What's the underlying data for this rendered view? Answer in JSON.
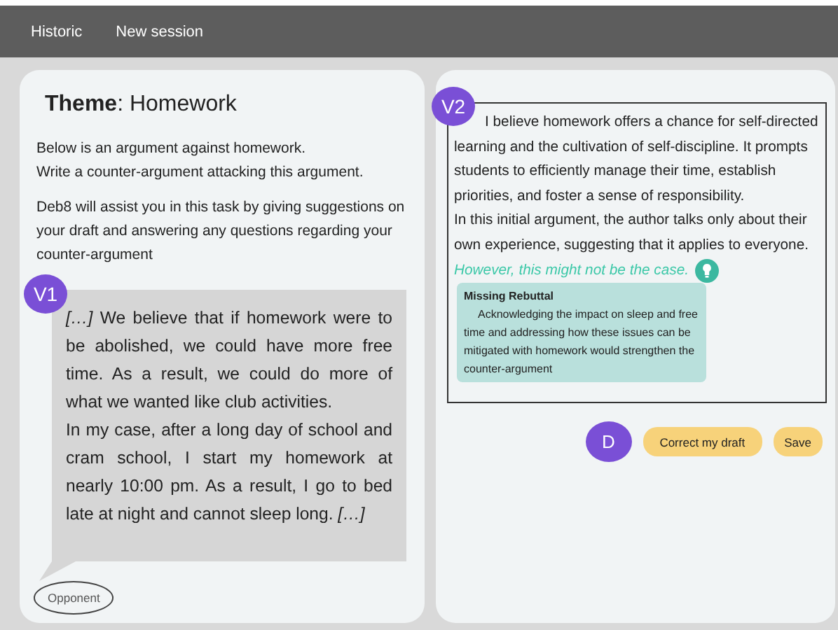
{
  "nav": [
    {
      "label": "Historic"
    },
    {
      "label": "New session"
    }
  ],
  "theme": {
    "text": "**Theme**: Homework"
  },
  "instructions": [
    "Below is an argument against homework.\nWrite a counter-argument attacking this argument.",
    "Deb8 will assist you in this task by giving suggestions on your draft and answering any questions regarding your counter-argument"
  ],
  "opponent": {
    "badge": "V1",
    "paragraphs": [
      "*[…]* We believe that if homework were to be abolished, we could have more free time. As a result, we could do more of what we wanted like club activities.",
      "In my case, after a long day of school and cram school, I start my homework at nearly 10:00 pm. As a result, I go to bed late at night and cannot sleep long. *[…]*"
    ],
    "speaker": "Opponent"
  },
  "draft": {
    "badge": "V2",
    "paragraphs": [
      "I believe homework offers a chance for self-directed learning and the cultivation of self-discipline. It prompts students to efficiently manage their time, establish priorities, and foster a sense of responsibility.",
      "In this initial argument, the author talks only about their own experience, suggesting that it applies to everyone."
    ],
    "highlight": "However, this might not be the case.",
    "suggestion": {
      "title": "Missing Rebuttal",
      "body": "Acknowledging the impact on sleep and free time and addressing how these issues can be mitigated with homework would strengthen the counter-argument"
    }
  },
  "actions": {
    "avatar": "D",
    "buttons": [
      {
        "label": "Correct my draft"
      },
      {
        "label": "Save"
      }
    ]
  }
}
